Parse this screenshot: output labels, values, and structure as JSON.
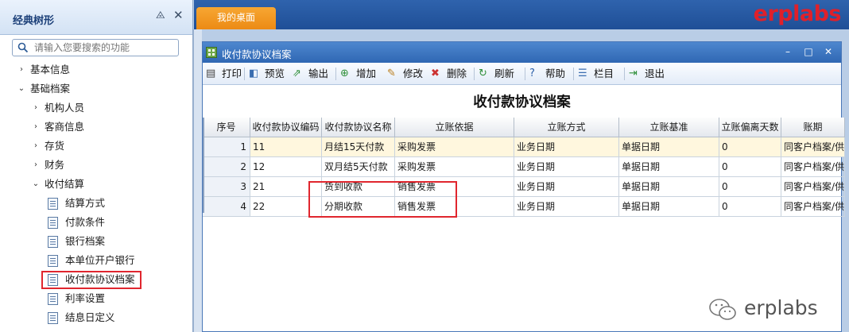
{
  "left_panel": {
    "title": "经典树形",
    "search_placeholder": "请输入您要搜索的功能",
    "tree": [
      {
        "label": "基本信息",
        "level": 0,
        "arrow": "›"
      },
      {
        "label": "基础档案",
        "level": 0,
        "arrow": "⌄"
      },
      {
        "label": "机构人员",
        "level": 1,
        "arrow": "›"
      },
      {
        "label": "客商信息",
        "level": 1,
        "arrow": "›"
      },
      {
        "label": "存货",
        "level": 1,
        "arrow": "›"
      },
      {
        "label": "财务",
        "level": 1,
        "arrow": "›"
      },
      {
        "label": "收付结算",
        "level": 1,
        "arrow": "⌄"
      },
      {
        "label": "结算方式",
        "level": 2
      },
      {
        "label": "付款条件",
        "level": 2
      },
      {
        "label": "银行档案",
        "level": 2
      },
      {
        "label": "本单位开户银行",
        "level": 2
      },
      {
        "label": "收付款协议档案",
        "level": 2,
        "highlighted": true
      },
      {
        "label": "利率设置",
        "level": 2
      },
      {
        "label": "结息日定义",
        "level": 2
      }
    ]
  },
  "topbar": {
    "tab_label": "我的桌面",
    "brand": "erplabs"
  },
  "window": {
    "title": "收付款协议档案",
    "toolbar": [
      {
        "label": "打印",
        "icon": "print-icon"
      },
      {
        "label": "预览",
        "icon": "preview-icon"
      },
      {
        "label": "输出",
        "icon": "export-icon"
      },
      {
        "label": "增加",
        "icon": "add-icon"
      },
      {
        "label": "修改",
        "icon": "edit-icon"
      },
      {
        "label": "删除",
        "icon": "delete-icon"
      },
      {
        "label": "刷新",
        "icon": "refresh-icon"
      },
      {
        "label": "帮助",
        "icon": "help-icon"
      },
      {
        "label": "栏目",
        "icon": "columns-icon"
      },
      {
        "label": "退出",
        "icon": "exit-icon"
      }
    ],
    "report_title": "收付款协议档案",
    "columns": [
      "序号",
      "收付款协议编码",
      "收付款协议名称",
      "立账依据",
      "立账方式",
      "立账基准",
      "立账偏离天数",
      "账期"
    ],
    "rows": [
      [
        "1",
        "11",
        "月结15天付款",
        "采购发票",
        "业务日期",
        "单据日期",
        "0",
        "同客户档案/供"
      ],
      [
        "2",
        "12",
        "双月结5天付款",
        "采购发票",
        "业务日期",
        "单据日期",
        "0",
        "同客户档案/供"
      ],
      [
        "3",
        "21",
        "货到收款",
        "销售发票",
        "业务日期",
        "单据日期",
        "0",
        "同客户档案/供"
      ],
      [
        "4",
        "22",
        "分期收款",
        "销售发票",
        "业务日期",
        "单据日期",
        "0",
        "同客户档案/供"
      ]
    ]
  },
  "watermark": {
    "text": "erplabs"
  },
  "colors": {
    "highlight": "#e0262e",
    "tab": "#ec8a14",
    "brand": "#e0202a"
  }
}
